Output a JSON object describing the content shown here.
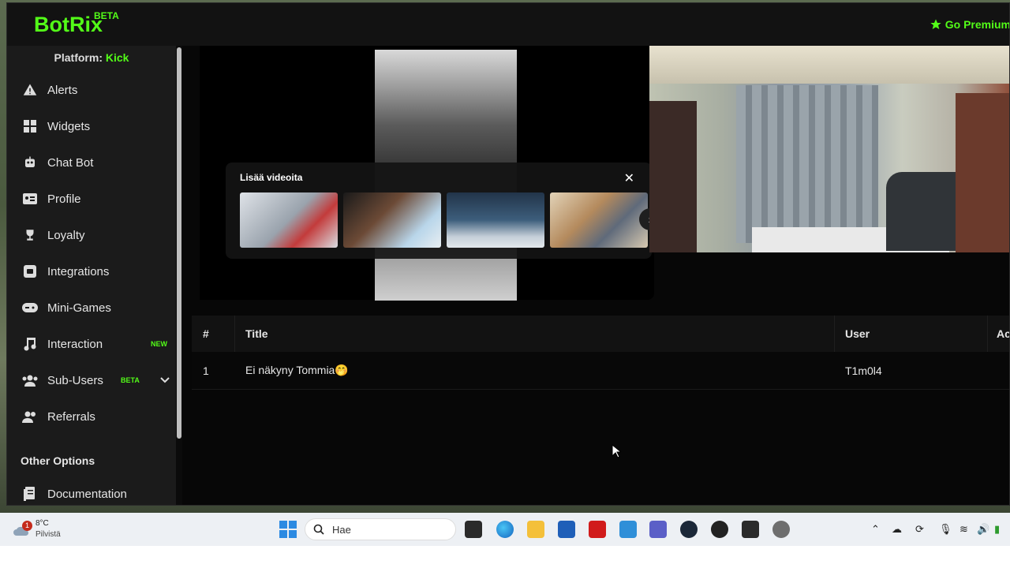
{
  "app": {
    "logo": "BotRix",
    "logo_badge": "BETA",
    "premium_label": "Go Premium"
  },
  "sidebar": {
    "platform_label": "Platform:",
    "platform_value": "Kick",
    "items": [
      {
        "label": "Alerts",
        "icon": "warning-triangle-icon"
      },
      {
        "label": "Widgets",
        "icon": "grid-icon"
      },
      {
        "label": "Chat Bot",
        "icon": "robot-icon"
      },
      {
        "label": "Profile",
        "icon": "id-card-icon"
      },
      {
        "label": "Loyalty",
        "icon": "trophy-icon"
      },
      {
        "label": "Integrations",
        "icon": "integrations-icon"
      },
      {
        "label": "Mini-Games",
        "icon": "gamepad-icon"
      },
      {
        "label": "Interaction",
        "icon": "music-note-icon",
        "badge": "NEW"
      },
      {
        "label": "Sub-Users",
        "icon": "users-icon",
        "badge": "BETA"
      },
      {
        "label": "Referrals",
        "icon": "user-group-icon"
      }
    ],
    "section_title": "Other Options",
    "section_items": [
      {
        "label": "Documentation",
        "icon": "document-icon"
      }
    ]
  },
  "player": {
    "overlay_title": "Lisää videoita"
  },
  "table": {
    "headers": [
      "#",
      "Title",
      "User",
      "Ac"
    ],
    "rows": [
      {
        "index": "1",
        "title": "Ei näkyny Tommia🤭",
        "user": "T1m0l4"
      }
    ]
  },
  "taskbar": {
    "weather_temp": "8°C",
    "weather_desc": "Pilvistä",
    "weather_badge": "1",
    "search_placeholder": "Hae"
  },
  "colors": {
    "accent": "#53fc18",
    "sidebar_bg": "#1b1b1b",
    "content_bg": "#070707",
    "taskbar_bg": "#edf0f4"
  }
}
